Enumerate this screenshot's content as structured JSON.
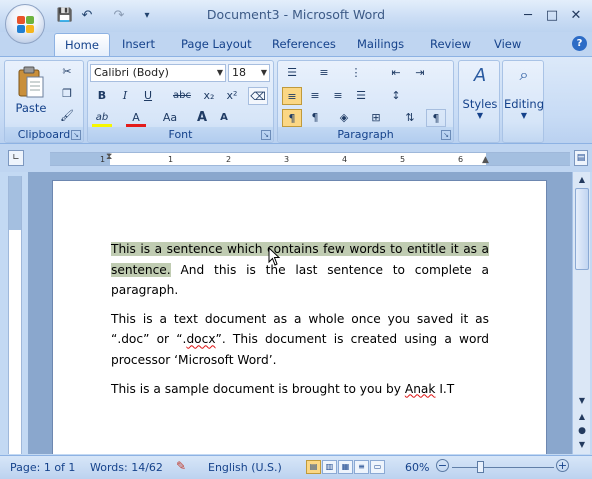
{
  "window": {
    "title": "Document3 - Microsoft Word",
    "controls": [
      "─",
      "□",
      "✕"
    ]
  },
  "quick_access": {
    "save": "💾",
    "undo": "↶",
    "redo": "↷",
    "customize": "▾"
  },
  "tabs": [
    {
      "label": "Home",
      "active": true
    },
    {
      "label": "Insert"
    },
    {
      "label": "Page Layout"
    },
    {
      "label": "References"
    },
    {
      "label": "Mailings"
    },
    {
      "label": "Review"
    },
    {
      "label": "View"
    }
  ],
  "ribbon": {
    "clipboard": {
      "label": "Clipboard",
      "paste_label": "Paste"
    },
    "font": {
      "label": "Font",
      "font_name": "Calibri (Body)",
      "font_size": "18",
      "bold": "B",
      "italic": "I",
      "underline": "U",
      "strike": "abc",
      "subscript": "x₂",
      "superscript": "x²",
      "grow": "A",
      "shrink": "A",
      "change_case": "Aa",
      "highlight": "ab",
      "font_color": "A"
    },
    "paragraph": {
      "label": "Paragraph"
    },
    "styles": {
      "label": "Styles"
    },
    "editing": {
      "label": "Editing"
    }
  },
  "ruler": {
    "ticks": [
      "1",
      "1",
      "2",
      "3",
      "4",
      "5",
      "6"
    ]
  },
  "document": {
    "paragraphs": [
      {
        "highlighted": "This is a sentence which contains few words to entitle it as a sentence.",
        "rest": " And this is the last sentence to complete a paragraph."
      },
      {
        "pre": "This is a text document as a whole once you saved it as “.doc” or “.",
        "squiggle": "docx",
        "post": "”. This document is created using a word processor ‘Microsoft Word’."
      },
      {
        "pre": "This is a sample document is brought to you by ",
        "squiggle": "Anak",
        "post": " I.T"
      }
    ]
  },
  "status": {
    "page": "Page: 1 of 1",
    "words": "Words: 14/62",
    "language": "English (U.S.)",
    "zoom": "60%",
    "zoom_minus": "−",
    "zoom_plus": "+"
  }
}
